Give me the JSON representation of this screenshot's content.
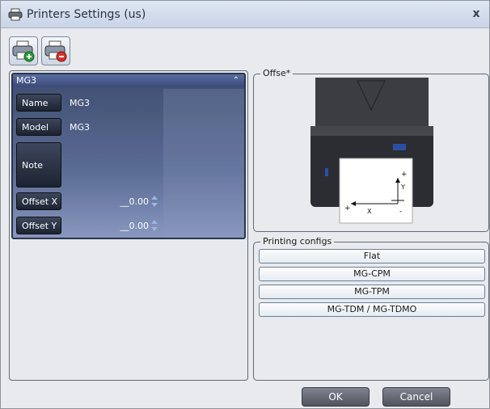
{
  "window": {
    "title": "Printers Settings (us)",
    "close_label": "x"
  },
  "toolbar": {
    "add_printer_icon": "add-printer-icon",
    "remove_printer_icon": "remove-printer-icon"
  },
  "printer": {
    "group_title": "MG3",
    "name_label": "Name",
    "name_value": "MG3",
    "model_label": "Model",
    "model_value": "MG3",
    "note_label": "Note",
    "note_value": "",
    "offset_x_label": "Offset X",
    "offset_x_value": "__0.00",
    "offset_y_label": "Offset Y",
    "offset_y_value": "__0.00"
  },
  "offset_panel": {
    "legend": "Offse*",
    "diagram_plus_y": "+",
    "diagram_y": "Y",
    "diagram_x": "X",
    "diagram_plus_x": "+",
    "diagram_minus_x": "-"
  },
  "printing_configs": {
    "legend": "Printing configs",
    "items": [
      "Flat",
      "MG-CPM",
      "MG-TPM",
      "MG-TDM / MG-TDMO"
    ]
  },
  "footer": {
    "ok_label": "OK",
    "cancel_label": "Cancel"
  },
  "colors": {
    "group_bg": "#4a5a80",
    "title_bar": "#d4deed",
    "button_dark": "#5a5f69"
  }
}
